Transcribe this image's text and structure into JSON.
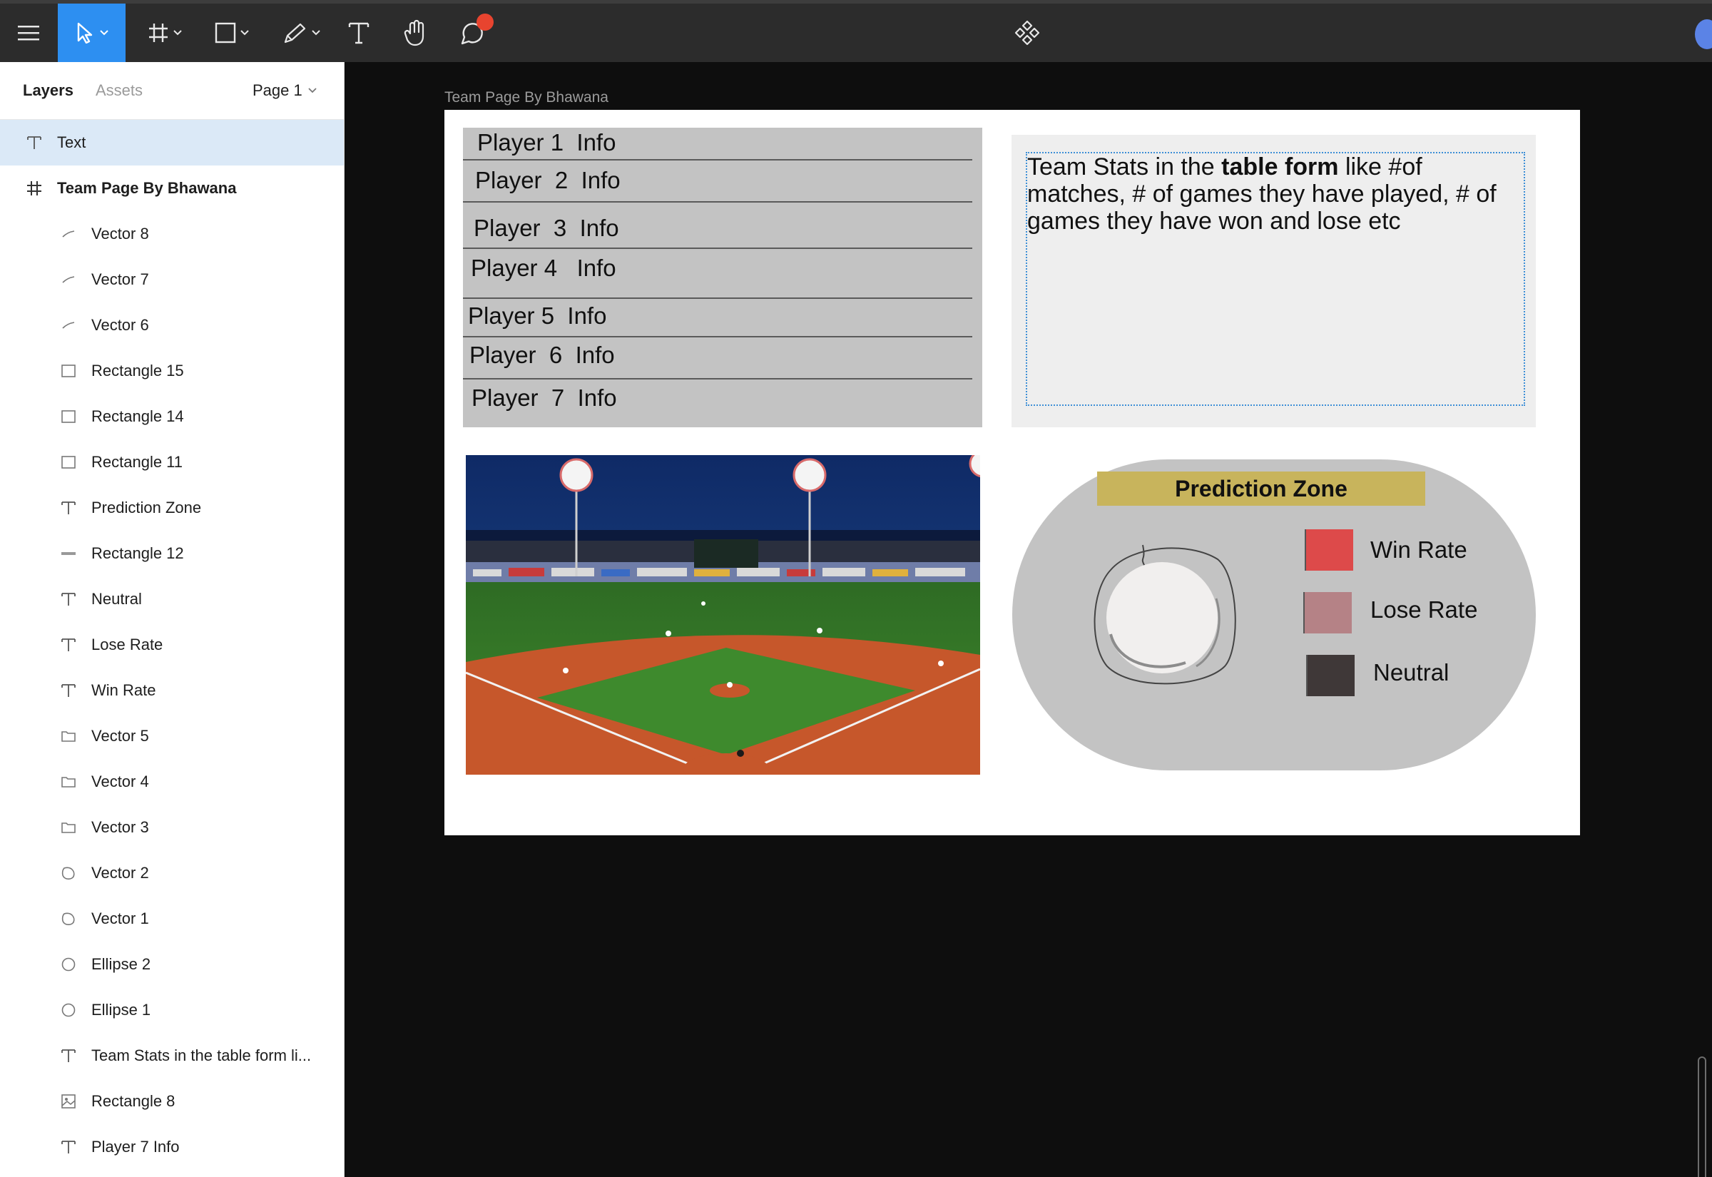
{
  "toolbar": {
    "tools": [
      "main-menu",
      "move-tool",
      "frame-tool",
      "shape-tool",
      "pen-tool",
      "text-tool",
      "hand-tool",
      "comment-tool",
      "components"
    ]
  },
  "sidebar": {
    "tab_layers": "Layers",
    "tab_assets": "Assets",
    "page": "Page 1",
    "layers": [
      {
        "label": "Text",
        "icon": "text-icon",
        "selected": true
      },
      {
        "label": "Team Page By Bhawana",
        "icon": "frame-icon",
        "bold": true
      },
      {
        "label": "Vector 8",
        "icon": "vector-icon"
      },
      {
        "label": "Vector 7",
        "icon": "vector-icon"
      },
      {
        "label": "Vector 6",
        "icon": "vector-icon"
      },
      {
        "label": "Rectangle 15",
        "icon": "rectangle-icon"
      },
      {
        "label": "Rectangle 14",
        "icon": "rectangle-icon"
      },
      {
        "label": "Rectangle 11",
        "icon": "rectangle-icon"
      },
      {
        "label": "Prediction Zone",
        "icon": "text-icon"
      },
      {
        "label": "Rectangle 12",
        "icon": "line-icon"
      },
      {
        "label": "Neutral",
        "icon": "text-icon"
      },
      {
        "label": "Lose Rate",
        "icon": "text-icon"
      },
      {
        "label": "Win Rate",
        "icon": "text-icon"
      },
      {
        "label": "Vector 5",
        "icon": "folder-vector-icon"
      },
      {
        "label": "Vector 4",
        "icon": "folder-vector-icon"
      },
      {
        "label": "Vector 3",
        "icon": "folder-vector-icon"
      },
      {
        "label": "Vector 2",
        "icon": "circle-vector-icon"
      },
      {
        "label": "Vector 1",
        "icon": "circle-vector-icon"
      },
      {
        "label": "Ellipse 2",
        "icon": "ellipse-icon"
      },
      {
        "label": "Ellipse 1",
        "icon": "ellipse-icon"
      },
      {
        "label": "Team Stats in the table form li...",
        "icon": "text-icon"
      },
      {
        "label": "Rectangle 8",
        "icon": "image-icon"
      },
      {
        "label": "Player 7 Info",
        "icon": "text-icon"
      }
    ]
  },
  "canvas": {
    "frame_label": "Team Page By Bhawana",
    "players": [
      "Player 1  Info",
      "Player  2  Info",
      "Player  3  Info",
      "Player 4   Info",
      "Player 5  Info",
      "Player  6  Info",
      "Player  7  Info"
    ],
    "stats": {
      "text_before": "Team Stats in the ",
      "text_bold": "table form",
      "text_after": " like #of matches, # of games they have played, # of games they have won and lose etc"
    },
    "prediction": {
      "title": "Prediction Zone",
      "legend": [
        {
          "label": "Win Rate",
          "color": "#dd4a4a"
        },
        {
          "label": "Lose Rate",
          "color": "#b58286"
        },
        {
          "label": "Neutral",
          "color": "#3f3838"
        }
      ]
    }
  }
}
